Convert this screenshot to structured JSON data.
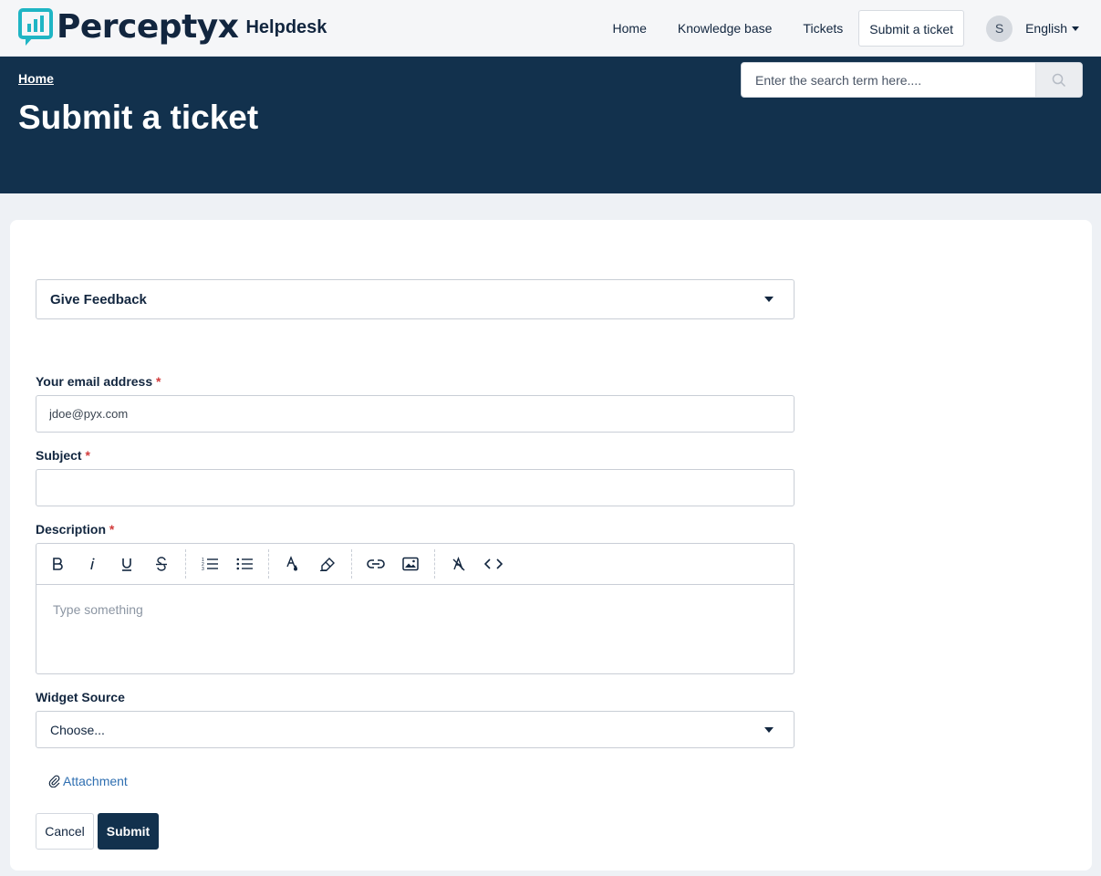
{
  "brand": {
    "name": "Perceptyx",
    "product": "Helpdesk",
    "color": "#12314d",
    "accent": "#1fb5c4"
  },
  "nav": {
    "items": [
      {
        "label": "Home"
      },
      {
        "label": "Knowledge base"
      },
      {
        "label": "Tickets"
      },
      {
        "label": "Submit a ticket",
        "active": true
      }
    ],
    "avatar_initial": "S",
    "language": "English"
  },
  "banner": {
    "breadcrumb": "Home",
    "title": "Submit a ticket",
    "search_placeholder": "Enter the search term here...."
  },
  "form": {
    "ticket_type": "Give Feedback",
    "email": {
      "label": "Your email address",
      "required_mark": "*",
      "value": "jdoe@pyx.com"
    },
    "subject": {
      "label": "Subject",
      "required_mark": "*",
      "value": ""
    },
    "description": {
      "label": "Description",
      "required_mark": "*",
      "placeholder": "Type something",
      "toolbar": [
        "bold-icon",
        "italic-icon",
        "underline-icon",
        "strikethrough-icon",
        "ordered-list-icon",
        "bulleted-list-icon",
        "text-color-icon",
        "highlight-icon",
        "link-icon",
        "image-icon",
        "clear-format-icon",
        "code-icon"
      ]
    },
    "widget_source": {
      "label": "Widget Source",
      "value": "Choose..."
    },
    "attachment_label": "Attachment",
    "cancel_label": "Cancel",
    "submit_label": "Submit"
  }
}
